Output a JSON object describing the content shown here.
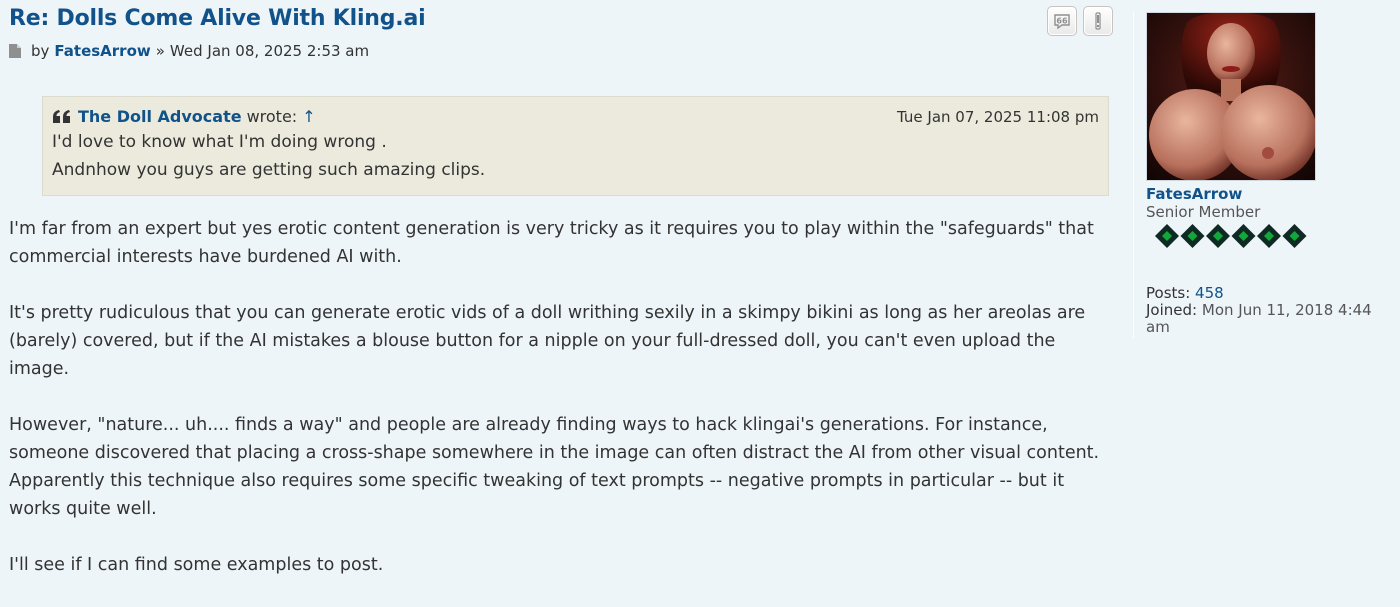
{
  "post": {
    "title": "Re: Dolls Come Alive With Kling.ai",
    "by_label": "by",
    "author": "FatesArrow",
    "separator": "»",
    "date": "Wed Jan 08, 2025 2:53 am"
  },
  "buttons": {
    "quote_icon": "quote-icon",
    "report_icon": "report-icon"
  },
  "quote": {
    "author": "The Doll Advocate",
    "wrote": "wrote:",
    "arrow": "↑",
    "date": "Tue Jan 07, 2025 11:08 pm",
    "lines": [
      "I'd love to know what I'm doing wrong .",
      "Andnhow you guys are getting such amazing clips."
    ]
  },
  "content": {
    "paragraphs": [
      "I'm far from an expert but yes erotic content generation is very tricky as it requires you to play within the \"safeguards\" that commercial interests have burdened AI with.",
      "It's pretty rudiculous that you can generate erotic vids of a doll writhing sexily in a skimpy bikini as long as her areolas are (barely) covered, but if the AI mistakes a blouse button for a nipple on your full-dressed doll, you can't even upload the image.",
      "However, \"nature... uh.... finds a way\" and people are already finding ways to hack klingai's generations. For instance, someone discovered that placing a cross-shape somewhere in the image can often distract the AI from other visual content. Apparently this technique also requires some specific tweaking of text prompts -- negative prompts in particular -- but it works quite well.",
      "I'll see if I can find some examples to post."
    ]
  },
  "profile": {
    "username": "FatesArrow",
    "rank": "Senior Member",
    "rank_diamonds": 6,
    "posts_label": "Posts:",
    "posts_value": "458",
    "joined_label": "Joined:",
    "joined_value": "Mon Jun 11, 2018 4:44 am"
  },
  "colors": {
    "link": "#105289",
    "background": "#eef5f9",
    "quote_bg": "#ebeadd",
    "diamond": "#11a83a"
  }
}
